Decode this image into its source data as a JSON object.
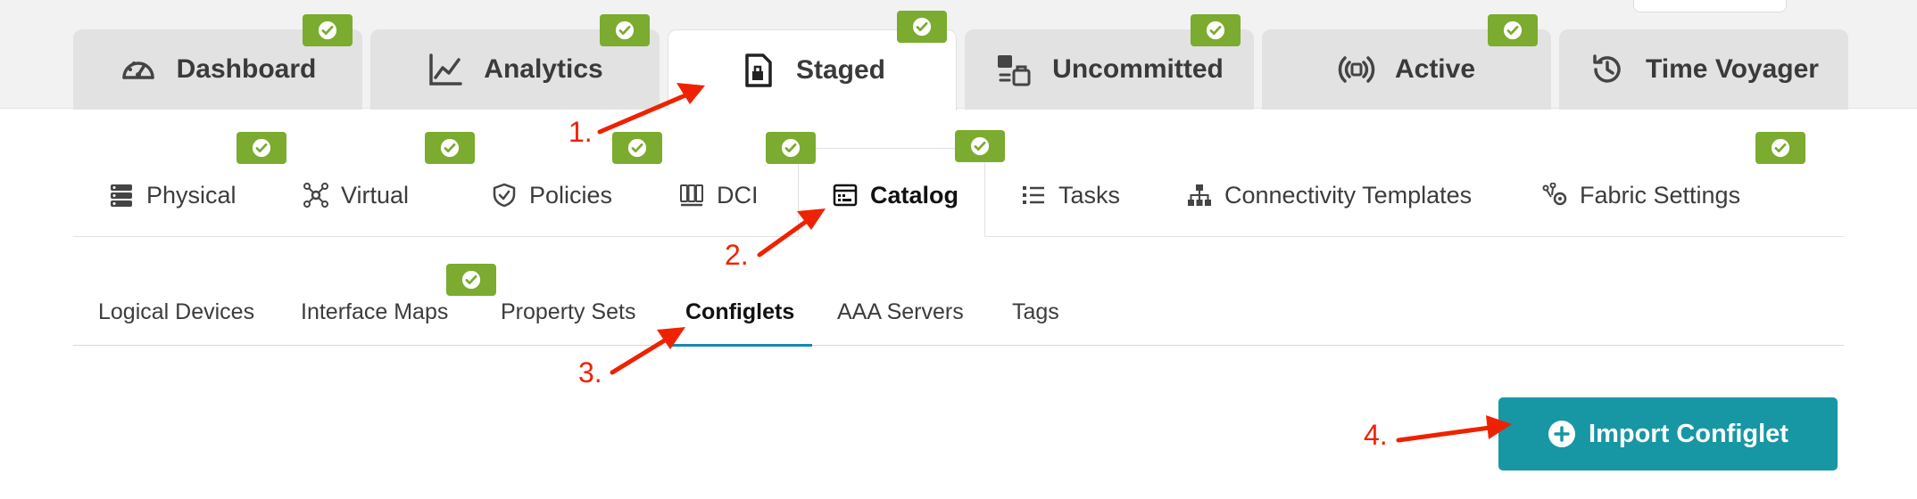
{
  "main_tabs": [
    {
      "label": "Dashboard",
      "icon": "gauge-icon"
    },
    {
      "label": "Analytics",
      "icon": "chart-line-icon"
    },
    {
      "label": "Staged",
      "icon": "staged-file-icon",
      "active": true
    },
    {
      "label": "Uncommitted",
      "icon": "uncommitted-icon"
    },
    {
      "label": "Active",
      "icon": "broadcast-icon"
    },
    {
      "label": "Time Voyager",
      "icon": "history-icon"
    }
  ],
  "sub_tabs": [
    {
      "label": "Physical",
      "icon": "server-stack-icon"
    },
    {
      "label": "Virtual",
      "icon": "network-nodes-icon"
    },
    {
      "label": "Policies",
      "icon": "shield-check-icon"
    },
    {
      "label": "DCI",
      "icon": "dci-icon"
    },
    {
      "label": "Catalog",
      "icon": "catalog-icon",
      "active": true
    },
    {
      "label": "Tasks",
      "icon": "list-icon"
    },
    {
      "label": "Connectivity Templates",
      "icon": "hierarchy-icon"
    },
    {
      "label": "Fabric Settings",
      "icon": "fabric-settings-icon"
    }
  ],
  "catalog_tabs": [
    {
      "label": "Logical Devices"
    },
    {
      "label": "Interface Maps"
    },
    {
      "label": "Property Sets"
    },
    {
      "label": "Configlets",
      "active": true
    },
    {
      "label": "AAA Servers"
    },
    {
      "label": "Tags"
    }
  ],
  "import_button": {
    "label": "Import Configlet",
    "icon": "plus-circle-icon"
  },
  "callouts": [
    "1.",
    "2.",
    "3.",
    "4."
  ],
  "colors": {
    "badge_green": "#7bab2f",
    "button_teal": "#1796a4",
    "callout_red": "#ee2200",
    "active_underline": "#1a86b8"
  }
}
